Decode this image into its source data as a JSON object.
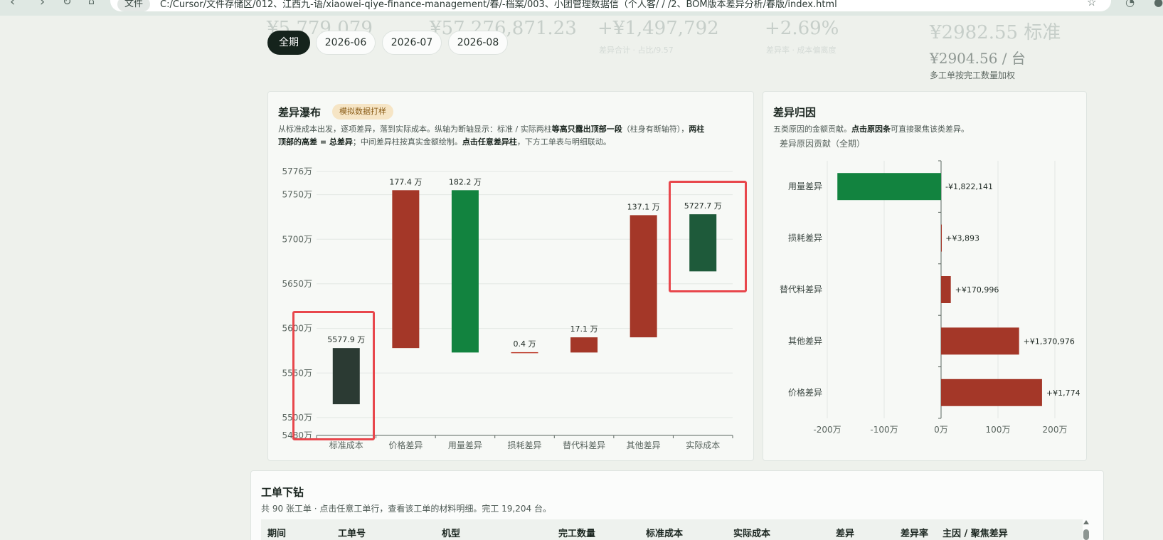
{
  "browser": {
    "security_label": "文件",
    "url": "C:/Cursor/文件存储区/012、江西九-语/xiaowei-qiye-finance-management/春/-档案/003、小团管理数据信（个人客/ / /2、BOM版本差异分析/春版/index.html"
  },
  "kpis": {
    "kpi1_value": "¥5,779,079",
    "kpi2_value": "¥57,276,871.23",
    "kpi3_value": "+¥1,497,792",
    "kpi3_sub": "差异合计 · 占比/9.57",
    "kpi4_value": "+2.69%",
    "kpi4_sub": "差异率 · 成本偏离度",
    "kpi5_value": "¥2982.55 标准",
    "kpi5_actual": "¥2904.56 / 台",
    "kpi5_note": "多工单按完工数量加权"
  },
  "periods": [
    "全期",
    "2026-06",
    "2026-07",
    "2026-08"
  ],
  "waterfall": {
    "title": "差异瀑布",
    "badge": "模拟数据打样",
    "desc_lines": [
      [
        {
          "t": "从标准成本出发，逐项差异，落到实际成本。纵轴为断轴显示：标准 / 实际两柱",
          "b": false
        },
        {
          "t": "等高只露出顶部一段",
          "b": true
        },
        {
          "t": "（柱身有断轴符），",
          "b": false
        },
        {
          "t": "两柱",
          "b": true
        }
      ],
      [
        {
          "t": "顶部的高差 = 总差异",
          "b": true
        },
        {
          "t": "；中间差异柱按真实金额绘制。",
          "b": false
        },
        {
          "t": "点击任意差异柱",
          "b": true
        },
        {
          "t": "，下方工单表与明细联动。",
          "b": false
        }
      ]
    ]
  },
  "attribution": {
    "title": "差异归因",
    "desc_lines": [
      [
        {
          "t": "五类原因的金额贡献。",
          "b": false
        },
        {
          "t": "点击原因条",
          "b": true
        },
        {
          "t": "可直接聚焦该类差异。",
          "b": false
        }
      ]
    ],
    "chart_title": "差异原因贡献（全期）"
  },
  "chart_data": [
    {
      "type": "bar",
      "subtype": "waterfall",
      "title": "差异瀑布",
      "categories": [
        "标准成本",
        "价格差异",
        "用量差异",
        "损耗差异",
        "替代料差异",
        "其他差异",
        "实际成本"
      ],
      "ranges": [
        [
          5515,
          5578
        ],
        [
          5578,
          5755
        ],
        [
          5573,
          5755
        ],
        [
          5573,
          5573.4
        ],
        [
          5573,
          5590
        ],
        [
          5590,
          5727
        ],
        [
          5664,
          5728
        ]
      ],
      "labels": [
        "5577.9 万",
        "177.4 万",
        "182.2 万",
        "0.4 万",
        "17.1 万",
        "137.1 万",
        "5727.7 万"
      ],
      "colors": [
        "#2b3a33",
        "#a43728",
        "#12833f",
        "#c24a3b",
        "#a43728",
        "#a43728",
        "#1e5a3a"
      ],
      "ylim": [
        5480,
        5776
      ],
      "yticks": [
        5480,
        5500,
        5550,
        5600,
        5650,
        5700,
        5750,
        5776
      ],
      "ytick_labels": [
        "5480万",
        "5500万",
        "5550万",
        "5600万",
        "5650万",
        "5700万",
        "5750万",
        "5776万"
      ],
      "grid": true,
      "unit": "万"
    },
    {
      "type": "bar",
      "orientation": "horizontal",
      "title": "差异原因贡献（全期）",
      "categories": [
        "用量差异",
        "损耗差异",
        "替代料差异",
        "其他差异",
        "价格差异"
      ],
      "values": [
        -1822141,
        3893,
        170996,
        1370976,
        1774000
      ],
      "labels": [
        "-¥1,822,141",
        "+¥3,893",
        "+¥170,996",
        "+¥1,370,976",
        "+¥1,774"
      ],
      "colors": [
        "#12833f",
        "#a43728",
        "#a43728",
        "#a43728",
        "#a43728"
      ],
      "xlim": [
        -2000000,
        2000000
      ],
      "xticks": [
        -2000000,
        -1000000,
        0,
        1000000,
        2000000
      ],
      "xtick_labels": [
        "-200万",
        "-100万",
        "0万",
        "100万",
        "200万"
      ],
      "grid": true
    }
  ],
  "drilldown": {
    "title": "工单下钻",
    "subtitle": "共 90 张工单 · 点击任意工单行，查看该工单的材料明细。完工 19,204 台。",
    "headers": [
      "期间",
      "工单号",
      "机型",
      "完工数量",
      "标准成本",
      "实际成本",
      "差异",
      "差异率",
      "主因 / 聚焦差异"
    ]
  }
}
